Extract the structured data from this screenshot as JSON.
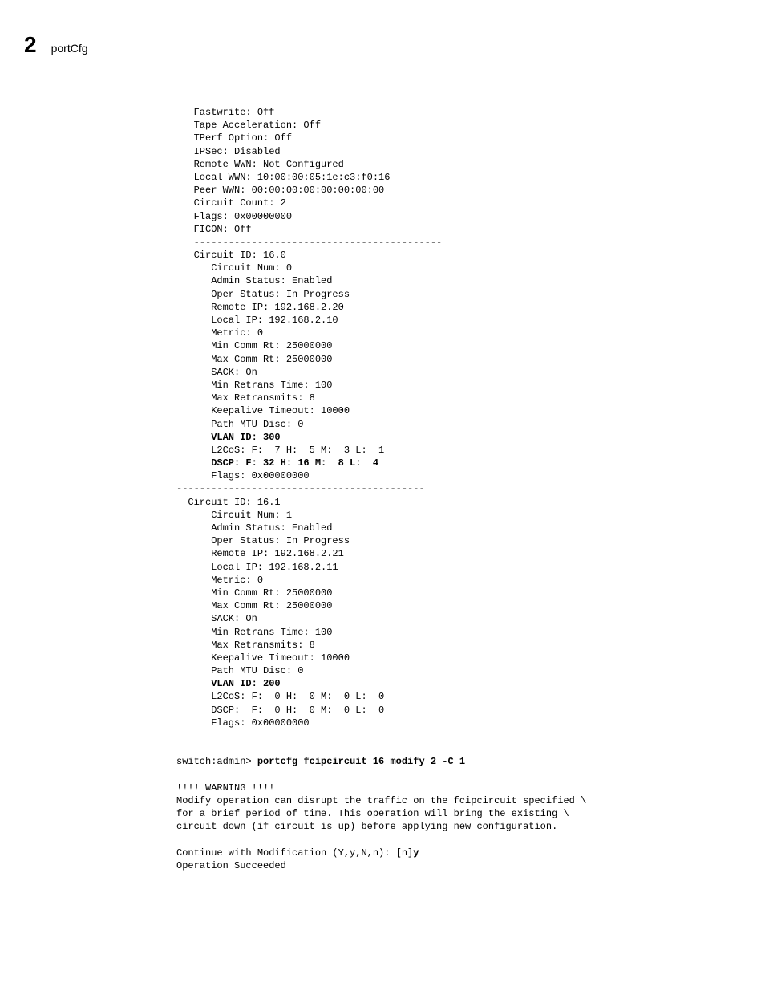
{
  "header": {
    "chapter_number": "2",
    "chapter_title": "portCfg"
  },
  "block1": {
    "lines": [
      "   Fastwrite: Off",
      "   Tape Acceleration: Off",
      "   TPerf Option: Off",
      "   IPSec: Disabled",
      "   Remote WWN: Not Configured",
      "   Local WWN: 10:00:00:05:1e:c3:f0:16",
      "   Peer WWN: 00:00:00:00:00:00:00:00",
      "   Circuit Count: 2",
      "   Flags: 0x00000000",
      "   FICON: Off",
      "   -------------------------------------------",
      "   Circuit ID: 16.0",
      "      Circuit Num: 0",
      "      Admin Status: Enabled",
      "      Oper Status: In Progress",
      "      Remote IP: 192.168.2.20",
      "      Local IP: 192.168.2.10",
      "      Metric: 0",
      "      Min Comm Rt: 25000000",
      "      Max Comm Rt: 25000000",
      "      SACK: On",
      "      Min Retrans Time: 100",
      "      Max Retransmits: 8",
      "      Keepalive Timeout: 10000",
      "      Path MTU Disc: 0"
    ],
    "vlan1": "      VLAN ID: 300",
    "l2cos1": "      L2CoS: F:  7 H:  5 M:  3 L:  1",
    "dscp1": "      DSCP: F: 32 H: 16 M:  8 L:  4",
    "flags1": "      Flags: 0x00000000",
    "sep": "-------------------------------------------",
    "lines2": [
      "  Circuit ID: 16.1",
      "      Circuit Num: 1",
      "      Admin Status: Enabled",
      "      Oper Status: In Progress",
      "      Remote IP: 192.168.2.21",
      "      Local IP: 192.168.2.11",
      "      Metric: 0",
      "      Min Comm Rt: 25000000",
      "      Max Comm Rt: 25000000",
      "      SACK: On",
      "      Min Retrans Time: 100",
      "      Max Retransmits: 8",
      "      Keepalive Timeout: 10000",
      "      Path MTU Disc: 0"
    ],
    "vlan2": "      VLAN ID: 200",
    "l2cos2": "      L2CoS: F:  0 H:  0 M:  0 L:  0",
    "dscp2": "      DSCP:  F:  0 H:  0 M:  0 L:  0",
    "flags2": "      Flags: 0x00000000"
  },
  "cmd": {
    "prompt": "switch:admin> ",
    "command": "portcfg fcipcircuit 16 modify 2 -C 1"
  },
  "warn": {
    "l1": "!!!! WARNING !!!!",
    "l2": "Modify operation can disrupt the traffic on the fcipcircuit specified \\",
    "l3": "for a brief period of time. This operation will bring the existing \\",
    "l4": "circuit down (if circuit is up) before applying new configuration.",
    "l5": "",
    "l6a": "Continue with Modification (Y,y,N,n): [n]",
    "l6b": "y",
    "l7": "Operation Succeeded"
  }
}
